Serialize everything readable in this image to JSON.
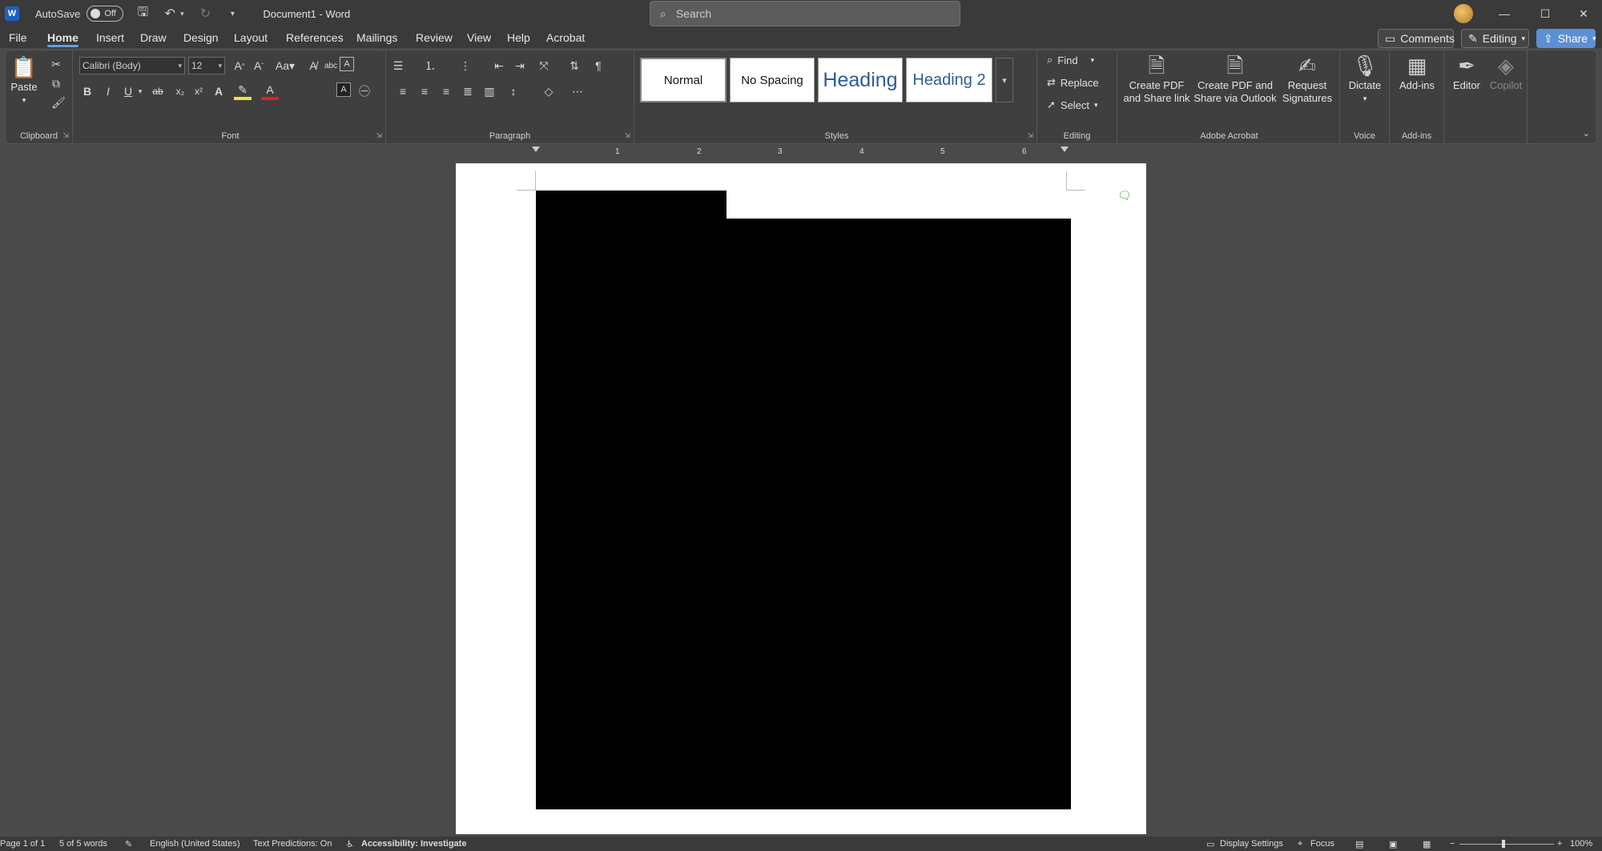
{
  "titlebar": {
    "autosave_label": "AutoSave",
    "autosave_state": "Off",
    "doc_title": "Document1  -  Word",
    "search_placeholder": "Search",
    "window_controls": [
      "—",
      "☐",
      "✕"
    ]
  },
  "menu": {
    "tabs": [
      "File",
      "Home",
      "Insert",
      "Draw",
      "Design",
      "Layout",
      "References",
      "Mailings",
      "Review",
      "View",
      "Help",
      "Acrobat"
    ],
    "active_tab": "Home",
    "comments_label": "Comments",
    "editing_label": "Editing",
    "share_label": "Share"
  },
  "ribbon": {
    "clipboard": {
      "label": "Clipboard",
      "paste": "Paste"
    },
    "font": {
      "label": "Font",
      "font_name": "Calibri (Body)",
      "font_size": "12"
    },
    "paragraph": {
      "label": "Paragraph"
    },
    "styles": {
      "label": "Styles",
      "items": [
        "Normal",
        "No Spacing",
        "Heading",
        "Heading 2"
      ]
    },
    "editing": {
      "label": "Editing",
      "find": "Find",
      "replace": "Replace",
      "select": "Select"
    },
    "acrobat": {
      "label": "Adobe Acrobat",
      "create_share_line1": "Create PDF",
      "create_share_line2": "and Share link",
      "create_outlook_line1": "Create PDF and",
      "create_outlook_line2": "Share via Outlook",
      "request_line1": "Request",
      "request_line2": "Signatures"
    },
    "voice": {
      "label": "Voice",
      "dictate": "Dictate"
    },
    "addins": {
      "label": "Add-ins",
      "addins": "Add-ins"
    },
    "editor": "Editor",
    "copilot": "Copilot"
  },
  "ruler": {
    "numbers": [
      "1",
      "2",
      "3",
      "4",
      "5",
      "6"
    ]
  },
  "status": {
    "page": "Page 1 of 1",
    "words": "5 of 5 words",
    "language": "English (United States)",
    "predictions": "Text Predictions: On",
    "accessibility": "Accessibility: Investigate",
    "display_settings": "Display Settings",
    "focus": "Focus",
    "zoom": "100%"
  },
  "colors": {
    "accent": "#5fa0e8",
    "share": "#5d8fd3",
    "page": "#ffffff",
    "redaction": "#000000"
  }
}
